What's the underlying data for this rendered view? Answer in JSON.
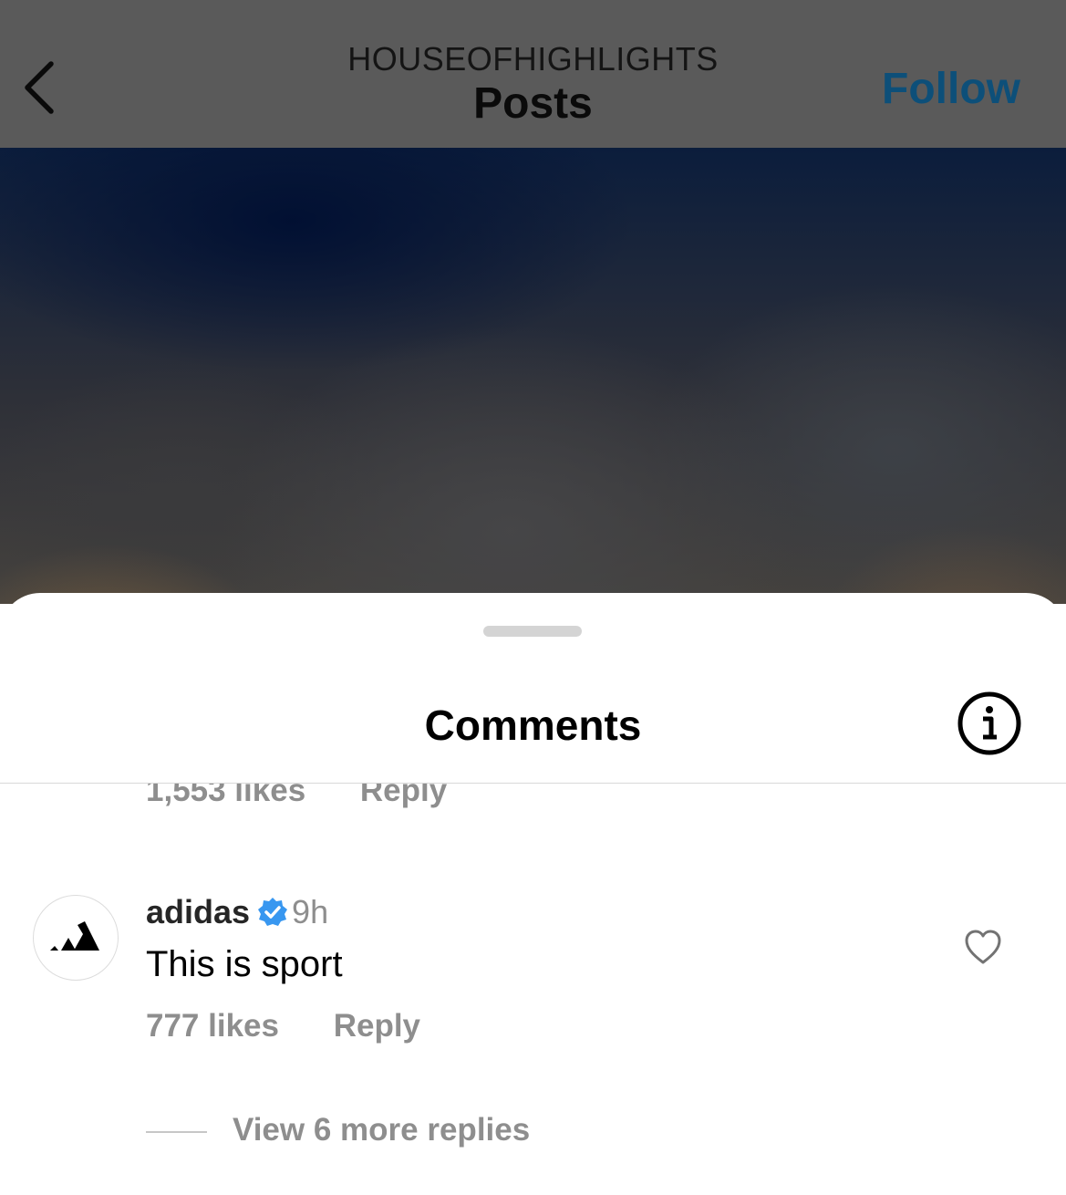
{
  "header": {
    "account_name": "HOUSEOFHIGHLIGHTS",
    "title": "Posts",
    "follow_label": "Follow",
    "back_icon": "chevron-left-icon"
  },
  "sheet": {
    "title": "Comments",
    "info_icon": "info-icon"
  },
  "comments": [
    {
      "likes": "1,553 likes",
      "reply_label": "Reply"
    },
    {
      "username": "adidas",
      "verified": true,
      "time": "9h",
      "text": "This is sport",
      "likes": "777 likes",
      "reply_label": "Reply",
      "view_replies": "View 6 more replies",
      "like_icon": "heart-icon"
    }
  ],
  "colors": {
    "follow": "#0d4f79",
    "verified_badge": "#3897f0",
    "meta_text": "#8e8e8e"
  }
}
